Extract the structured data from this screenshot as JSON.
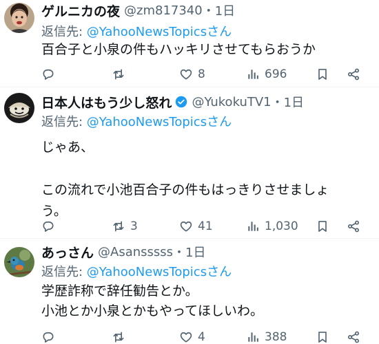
{
  "tweets": [
    {
      "name": "ゲルニカの夜",
      "handle": "@zm817340",
      "time": "・1日",
      "reply_prefix": "返信先: ",
      "reply_to": "@YahooNewsTopics",
      "reply_suffix": "さん",
      "text": "百合子と小泉の件もハッキリさせてもらおうか",
      "reply_count": "",
      "retweet_count": "",
      "like_count": "8",
      "view_count": "696"
    },
    {
      "name": "日本人はもう少し怒れ",
      "handle": "@YukokuTV1",
      "time": "・1日",
      "reply_prefix": "返信先: ",
      "reply_to": "@YahooNewsTopics",
      "reply_suffix": "さん",
      "text": "じゃあ、\n\nこの流れで小池百合子の件もはっきりさせましょう。",
      "reply_count": "",
      "retweet_count": "3",
      "like_count": "41",
      "view_count": "1,030"
    },
    {
      "name": "あっさん",
      "handle": "@Asansssss",
      "time": "・1日",
      "reply_prefix": "返信先: ",
      "reply_to": "@YahooNewsTopics",
      "reply_suffix": "さん",
      "text": "学歴詐称で辞任勧告とか。\n小池とか小泉とかもやってほしいわ。",
      "reply_count": "",
      "retweet_count": "",
      "like_count": "4",
      "view_count": "388"
    }
  ],
  "icons": {
    "reply": "speech-bubble-icon",
    "retweet": "retweet-arrows-icon",
    "like": "heart-icon",
    "views": "bar-chart-icon",
    "bookmark": "bookmark-icon",
    "share": "share-icon",
    "verified": "verified-badge-icon"
  },
  "colors": {
    "text": "#0f1419",
    "secondary": "#536471",
    "link": "#1d9bf0",
    "verified": "#1d9bf0",
    "separator": "#eff3f4"
  }
}
